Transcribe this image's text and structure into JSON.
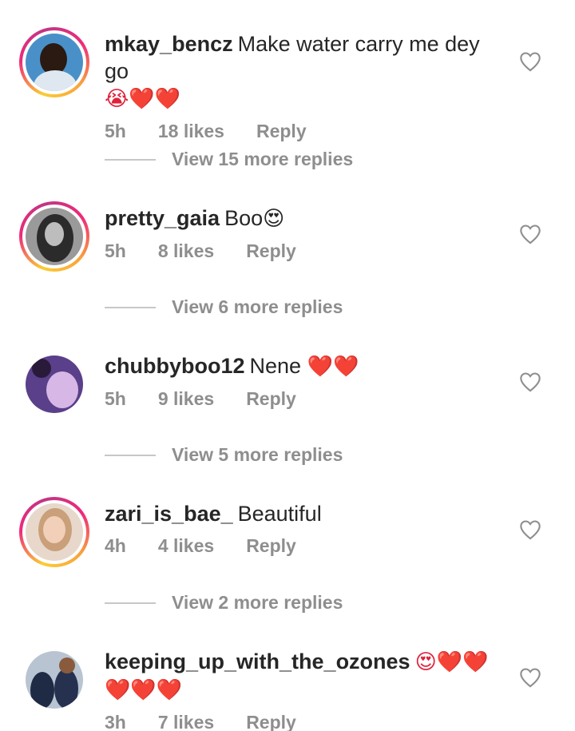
{
  "comments": [
    {
      "username": "mkay_bencz",
      "text": "Make water carry me dey go",
      "emojis": "😭❤️❤️",
      "time": "5h",
      "likes": "18 likes",
      "reply": "Reply",
      "view_more": "View 15 more replies",
      "story_ring": true
    },
    {
      "username": "pretty_gaia",
      "text": "Boo",
      "emojis": "😍",
      "time": "5h",
      "likes": "8 likes",
      "reply": "Reply",
      "view_more": "View 6 more replies",
      "story_ring": true
    },
    {
      "username": "chubbyboo12",
      "text": "Nene",
      "emojis": "❤️❤️",
      "time": "5h",
      "likes": "9 likes",
      "reply": "Reply",
      "view_more": "View 5 more replies",
      "story_ring": false
    },
    {
      "username": "zari_is_bae_",
      "text": "Beautiful",
      "emojis": "",
      "time": "4h",
      "likes": "4 likes",
      "reply": "Reply",
      "view_more": "View 2 more replies",
      "story_ring": true
    },
    {
      "username": "keeping_up_with_the_ozones",
      "text": "",
      "emojis": "😍❤️❤️ ❤️❤️❤️",
      "time": "3h",
      "likes": "7 likes",
      "reply": "Reply",
      "view_more": "",
      "story_ring": false
    }
  ],
  "icons": {
    "like": "heart-outline-icon"
  },
  "colors": {
    "primary_text": "#262626",
    "secondary_text": "#8e8e8e",
    "divider": "#c7c7c7"
  }
}
